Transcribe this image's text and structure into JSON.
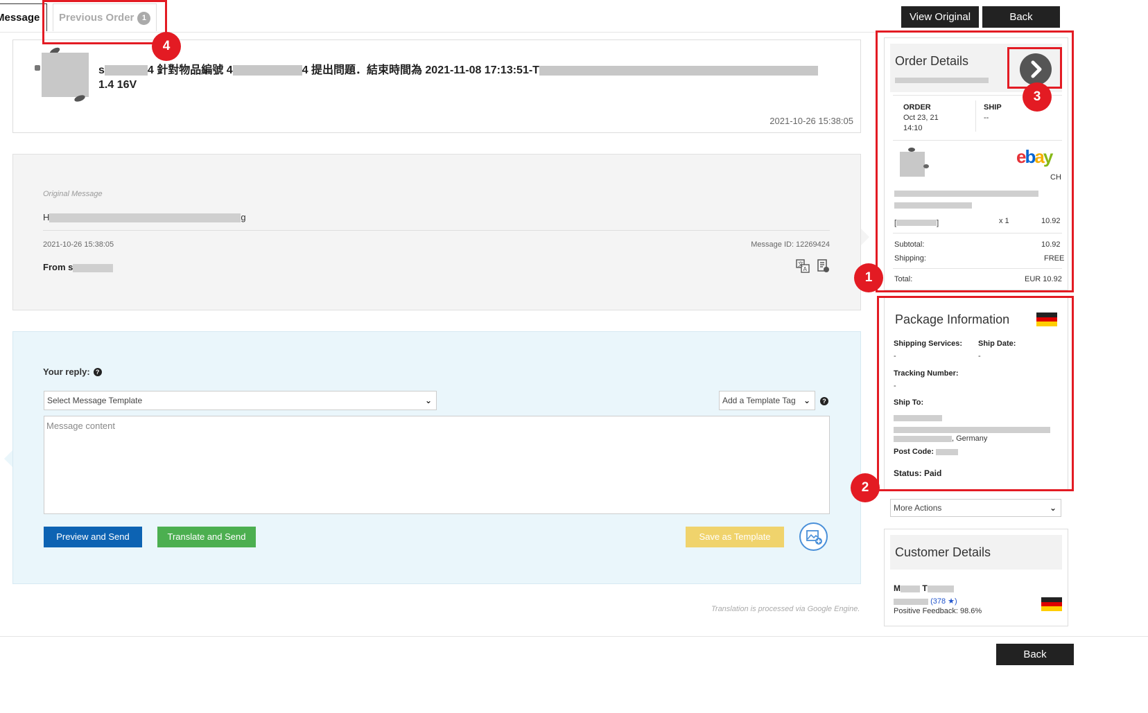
{
  "tabs": {
    "message": "Message",
    "previous_order": "Previous Order",
    "previous_order_count": "1"
  },
  "toolbar": {
    "view_original": "View Original",
    "back": "Back"
  },
  "annotations": [
    "1",
    "2",
    "3",
    "4"
  ],
  "message_header": {
    "subject_prefix": "s",
    "subject_mid1": "4 針對物品編號 4",
    "subject_mid2": "4 提出問題．結束時間為 2021-11-08 17:13:51-T",
    "subject_line2": "1.4 16V",
    "timestamp": "2021-10-26 15:38:05"
  },
  "original_message": {
    "label": "Original Message",
    "body_start": "H",
    "body_end": "g",
    "timestamp": "2021-10-26 15:38:05",
    "message_id": "Message ID: 12269424",
    "from_label": "From s"
  },
  "reply": {
    "label": "Your reply:",
    "template_select": "Select Message Template",
    "template_tag_select": "Add a Template Tag",
    "message_placeholder": "Message content",
    "preview_send": "Preview and Send",
    "translate_send": "Translate and Send",
    "save_template": "Save as Template"
  },
  "translate_note": "Translation is processed via Google Engine.",
  "order_details": {
    "title": "Order Details",
    "order_label": "ORDER",
    "order_date": "Oct 23, 21",
    "order_time": "14:10",
    "ship_label": "SHIP",
    "ship_value": "--",
    "platform": "ebay",
    "platform_site": "CH",
    "item_qty": "x 1",
    "item_price": "10.92",
    "subtotal_label": "Subtotal:",
    "subtotal_value": "10.92",
    "shipping_label": "Shipping:",
    "shipping_value": "FREE",
    "total_label": "Total:",
    "total_value": "EUR 10.92"
  },
  "package_info": {
    "title": "Package Information",
    "shipping_services_label": "Shipping Services:",
    "shipping_services_value": "-",
    "ship_date_label": "Ship Date:",
    "ship_date_value": "-",
    "tracking_label": "Tracking Number:",
    "tracking_value": "-",
    "ship_to_label": "Ship To:",
    "ship_to_country": ", Germany",
    "post_code_label": "Post Code:",
    "status": "Status: Paid"
  },
  "more_actions": "More Actions",
  "customer_details": {
    "title": "Customer Details",
    "name_initial_1": "M",
    "name_initial_2": "T",
    "feedback_count": "(378",
    "star": "★)",
    "positive_feedback": "Positive Feedback: 98.6%"
  },
  "bottom_back": "Back",
  "colors": {
    "annotation_red": "#e31b23",
    "primary_blue": "#0d63b3",
    "green": "#4caf50",
    "yellow": "#f0d36c",
    "dark_button": "#222222"
  }
}
